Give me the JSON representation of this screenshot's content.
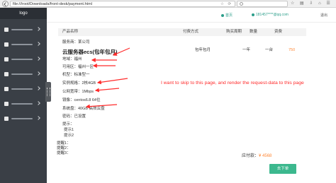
{
  "browser": {
    "url": "file:///root/Downloads/front-desk/payment.html",
    "search_placeholder": "",
    "address_icons": "☆ ⟳"
  },
  "sidebar": {
    "logo": "logo"
  },
  "header": {
    "home": "首页",
    "user": "181457****@qq.com",
    "exit": "退出"
  },
  "table": {
    "columns": [
      "产品名称",
      "付费方式",
      "购买周期",
      "数量",
      "资费"
    ],
    "provider": "服务商：某公司",
    "product": "云服务器ecs(包年包月)",
    "payment_method": "包年包月",
    "period": "一年",
    "quantity": "一台",
    "price": "750",
    "specs": [
      "地域：福州",
      "可用区：福州一区",
      "机型：标准型一",
      "实例规格：2核4GB",
      "公网宽带：1Mbps",
      "镜像：centos6.8 64位",
      "系统盘：40GB 高效云盘",
      "密码：已设置",
      "提示：",
      "提示1",
      "提示2"
    ],
    "extra_notes": [
      "提醒1：",
      "提醒2：",
      "提醒3："
    ]
  },
  "total": {
    "label": "应付款：",
    "value": "¥ 4568"
  },
  "pay_button": "去下单",
  "annotation": "I want to skip to this page, and render the request-data to this page",
  "colors": {
    "accent": "#3cb88e",
    "price": "#ff8a3a",
    "annotation": "#ff2b2b",
    "sidebar": "#3a3f46"
  }
}
